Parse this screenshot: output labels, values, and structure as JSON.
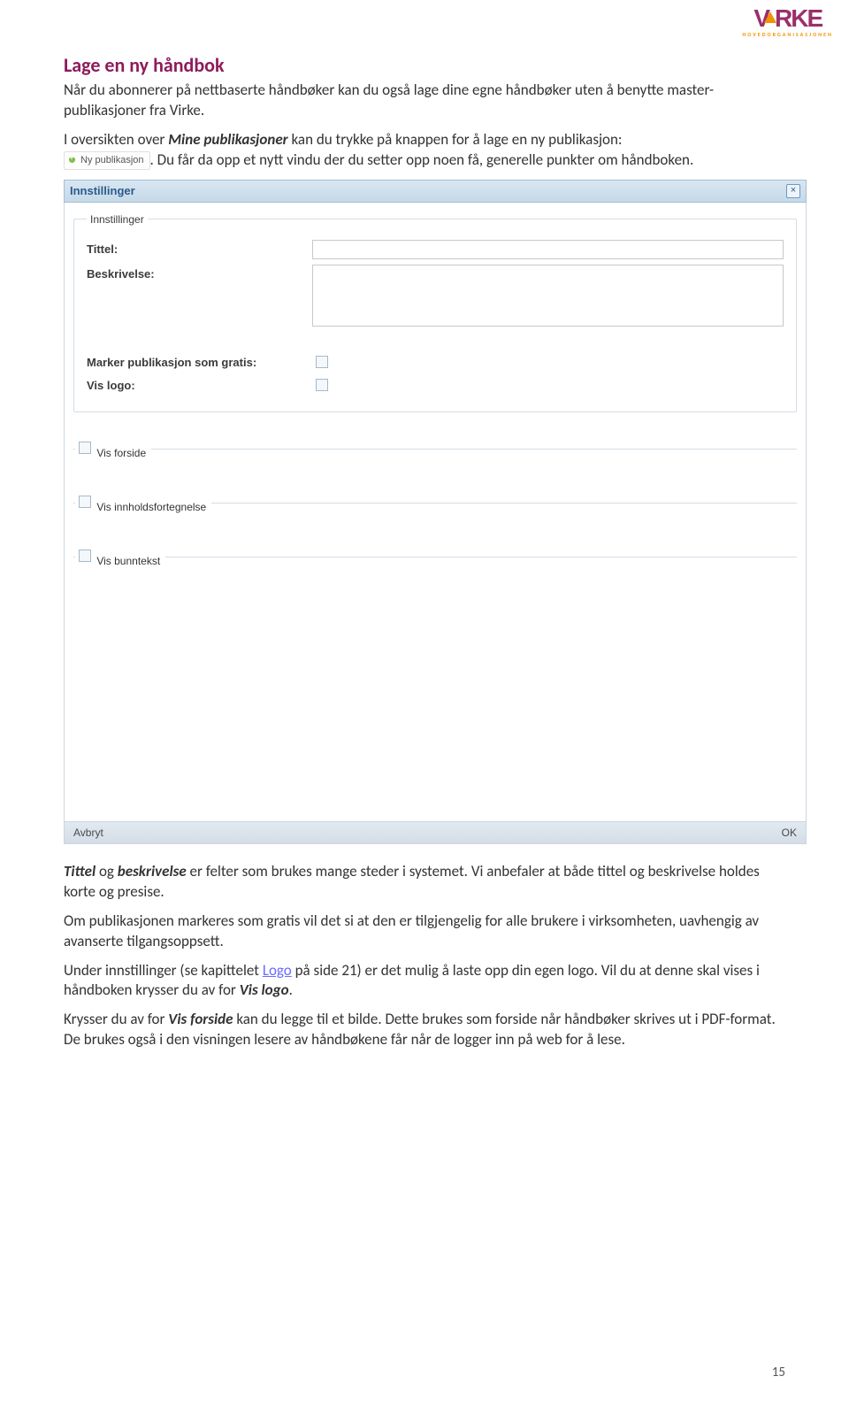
{
  "brand": {
    "name": "VIRKE",
    "tagline": "HOVEDORGANISASJONEN"
  },
  "heading": "Lage en ny håndbok",
  "intro1": "Når du abonnerer på nettbaserte håndbøker kan du også lage dine egne håndbøker uten å benytte master-publikasjoner fra Virke.",
  "intro2a": "I oversikten over ",
  "intro2_em": "Mine publikasjoner",
  "intro2b": " kan du trykke på knappen for å lage en ny publikasjon: ",
  "new_pub_label": "Ny publikasjon",
  "intro2c": ". Du får da opp et nytt vindu der du setter opp noen få, generelle punkter om håndboken.",
  "dialog": {
    "title": "Innstillinger",
    "group_legend": "Innstillinger",
    "labels": {
      "title": "Tittel:",
      "description": "Beskrivelse:",
      "free": "Marker publikasjon som gratis:",
      "logo": "Vis logo:",
      "cover": "Vis forside",
      "toc": "Vis innholdsfortegnelse",
      "footer": "Vis bunntekst"
    },
    "buttons": {
      "cancel": "Avbryt",
      "ok": "OK"
    }
  },
  "para1a": "Tittel",
  "para1b": " og ",
  "para1c": "beskrivelse",
  "para1d": " er felter som brukes mange steder i systemet. Vi anbefaler at både tittel og beskrivelse holdes korte og presise.",
  "para2": "Om publikasjonen markeres som gratis vil det si at den er tilgjengelig for alle brukere i virksomheten, uavhengig av avanserte tilgangsoppsett.",
  "para3a": "Under innstillinger (se kapittelet ",
  "para3_link": "Logo",
  "para3b": " på side 21) er det mulig å laste opp din egen logo. Vil du at denne skal vises i håndboken krysser du av for ",
  "para3_em": "Vis logo",
  "para3c": ".",
  "para4a": "Krysser du av for ",
  "para4_em": "Vis forside",
  "para4b": " kan du legge til et bilde. Dette brukes som forside når håndbøker skrives ut i PDF-format. De brukes også i den visningen lesere av håndbøkene får når de logger inn på web for å lese.",
  "page_number": "15"
}
